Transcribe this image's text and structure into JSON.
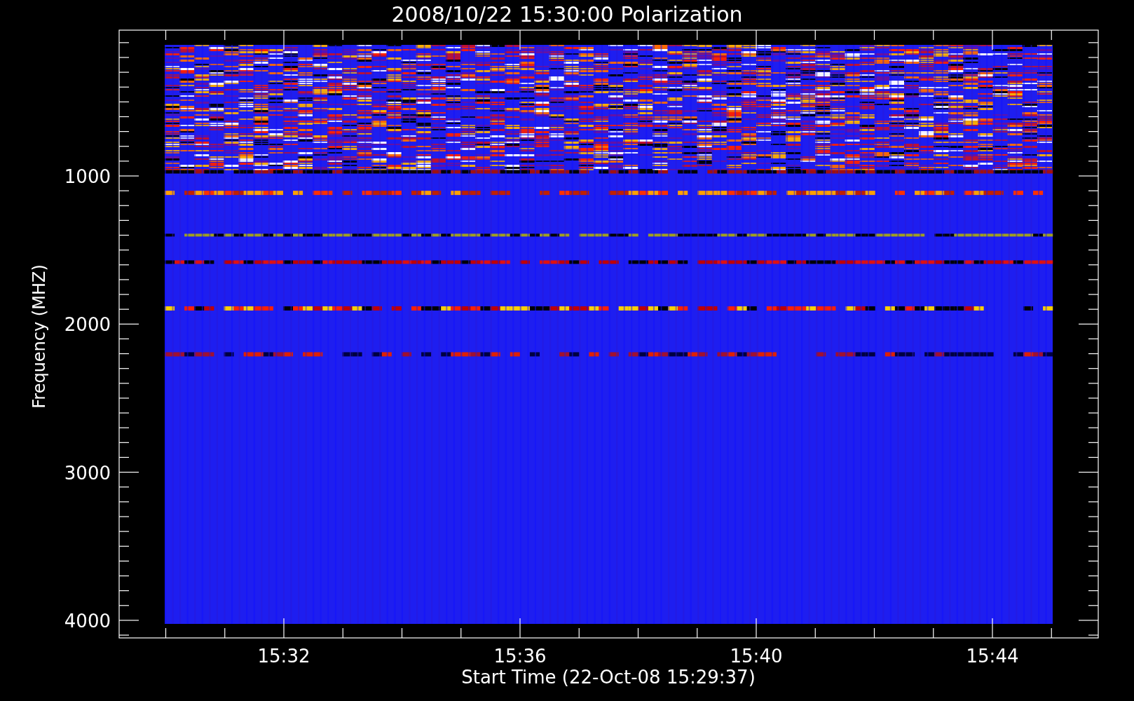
{
  "title": "2008/10/22 15:30:00 Polarization",
  "y_axis": {
    "title": "Frequency (MHZ)",
    "tick_labels": [
      "1000",
      "2000",
      "3000",
      "4000"
    ]
  },
  "x_axis": {
    "title": "Start Time (22-Oct-08 15:29:37)",
    "tick_labels": [
      "15:32",
      "15:36",
      "15:40",
      "15:44"
    ]
  }
}
